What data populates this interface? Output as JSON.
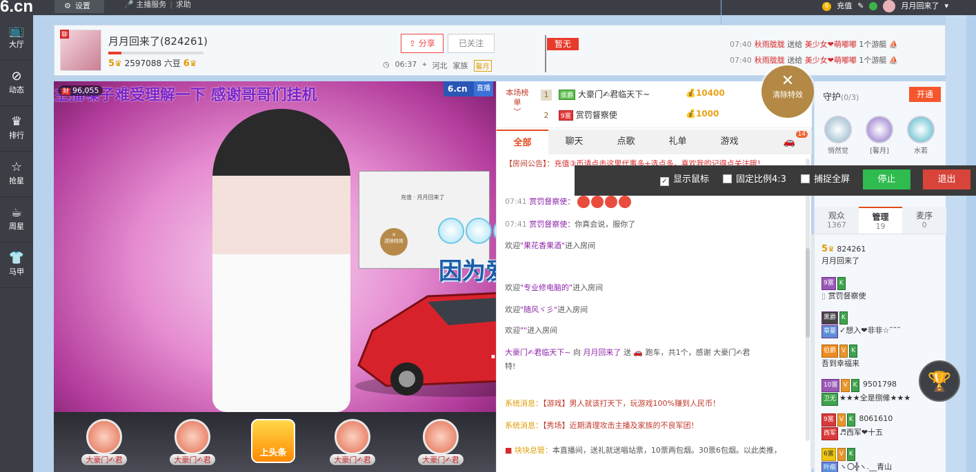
{
  "topbar": {
    "logo_text": "6.cn",
    "settings_label": "设置",
    "links": [
      "主播服务",
      "求助"
    ],
    "recharge_label": "充值",
    "user_name": "月月回来了"
  },
  "sidebar": {
    "items": [
      {
        "label": "大厅",
        "icon": "tv-icon",
        "glyph": "📺"
      },
      {
        "label": "动态",
        "icon": "compass-icon",
        "glyph": "⊘"
      },
      {
        "label": "排行",
        "icon": "crown-icon",
        "glyph": "♛"
      },
      {
        "label": "抢星",
        "icon": "star-icon",
        "glyph": "☆"
      },
      {
        "label": "周星",
        "icon": "cup-icon",
        "glyph": "☕"
      },
      {
        "label": "马甲",
        "icon": "shirt-icon",
        "glyph": "👕"
      }
    ]
  },
  "header": {
    "avatar_tag": "聊",
    "host_name": "月月回来了(824261)",
    "level_left": "5",
    "beans": "2597088 六豆",
    "level_right": "6",
    "share_label": "分享",
    "follow_label": "已关注",
    "time": "06:37",
    "location": "河北",
    "family_label": "家族",
    "family_tag": "馨月",
    "flag_label": "暂无"
  },
  "gift_feed": [
    {
      "time": "07:40",
      "from": "秋雨胧胧",
      "verb": "送给",
      "to": "美少女❤萌嘟嘟",
      "item": "1个游艇"
    },
    {
      "time": "07:40",
      "from": "秋雨胧胧",
      "verb": "送给",
      "to": "美少女❤萌嘟嘟",
      "item": "1个游艇"
    }
  ],
  "video": {
    "overlay_text": "主播嗓子难受理解一下    感谢哥哥们挂机",
    "viewer_tag": "财",
    "viewers": "96,055",
    "logo": "6.cn",
    "live_label": "直播",
    "subtitle": "因为爱你我哭过笑过",
    "mini_clear": "清除特效",
    "mini_recharge": "充值",
    "mini_user": "月月回来了"
  },
  "seats": {
    "label": "大豪门✍君",
    "top_label": "上头条"
  },
  "ranking": {
    "label": "本场榜单",
    "rows": [
      {
        "rank": "1",
        "badge": "侯爵",
        "name": "大豪门✍君临天下~",
        "value": "10400"
      },
      {
        "rank": "2",
        "badge": "9富",
        "name": "赏罚督察使",
        "value": "1000"
      }
    ]
  },
  "clear_effects": "清除特效",
  "chat": {
    "tabs": [
      "全部",
      "聊天",
      "点歌",
      "礼单",
      "游戏"
    ],
    "car_count": "14",
    "messages": [
      {
        "kind": "notice",
        "label": "【房间公告】：",
        "text": "充值③币请点击这里代事多+选点多，喜欢我的记得点关注哦！"
      },
      {
        "kind": "emote",
        "time": "07:41",
        "user": "赏罚督察使",
        "text": "："
      },
      {
        "kind": "say",
        "time": "07:41",
        "user": "赏罚督察使",
        "text": "：你真会说，服你了"
      },
      {
        "kind": "welcome",
        "pre": "欢迎",
        "user": "\"果花香果酒\"",
        "post": "进入房间"
      },
      {
        "kind": "welcome",
        "pre": "欢迎",
        "user": "\"专业修电脑的\"",
        "post": "进入房间"
      },
      {
        "kind": "welcome",
        "pre": "欢迎",
        "user": "\"随风ヾ彡\"",
        "post": "进入房间"
      },
      {
        "kind": "welcome",
        "pre": "欢迎",
        "user": "\"\"",
        "post": "进入房间"
      },
      {
        "kind": "gift",
        "user": "大豪门✍君临天下~",
        "mid": "向",
        "to": "月月回来了",
        "text": "送 🚗 跑车，共1个，感谢 大豪门✍君"
      },
      {
        "kind": "plain",
        "text": "特!"
      },
      {
        "kind": "sys",
        "label": "系统消息：",
        "text": "【游戏】男人就该打天下，玩游戏100%赚到人民币！"
      },
      {
        "kind": "sys",
        "label": "系统消息：",
        "text": "【秀场】近期清理攻击主播及家族的不良军团！"
      },
      {
        "kind": "sys2",
        "label": "块块总管：",
        "text": "本直播间，送礼就送唱站票，10票两包烟。30票6包烟。以此类推，"
      }
    ]
  },
  "toolbar": {
    "show_mouse": "显示鼠标",
    "fixed_ratio": "固定比例4:3",
    "capture_full": "捕捉全屏",
    "stop": "停止",
    "exit": "退出"
  },
  "guard": {
    "title": "守护",
    "count": "(0/3)",
    "open_label": "开通",
    "members": [
      "悄然觉",
      "[馨月]",
      "水若"
    ]
  },
  "user_tabs": [
    {
      "label": "观众",
      "count": "1367"
    },
    {
      "label": "管理",
      "count": "19"
    },
    {
      "label": "麦序",
      "count": "0"
    }
  ],
  "users": [
    {
      "lv": "5",
      "id": "824261",
      "name": "月月回来了"
    },
    {
      "badge": "9富",
      "k": "K",
      "name": "赏罚督察使"
    },
    {
      "badge": "黑爵",
      "k": "K",
      "tag": "草蔓",
      "name": "✓想入❤非非☆˜˜˜"
    },
    {
      "badge": "伯爵",
      "v": "V",
      "k": "K",
      "name": "吾到幸福来"
    },
    {
      "badge": "10富",
      "v": "V",
      "k": "K",
      "id": "9501798",
      "tag": "卫无",
      "name": "★★★全是捌絛★★★"
    },
    {
      "badge": "9富",
      "v": "V",
      "k": "K",
      "id": "8061610",
      "tag": "西军",
      "name": "♬西军❤十五"
    },
    {
      "badge": "6富",
      "v": "V",
      "k": "K",
      "tag": "叶痕",
      "name": "ヽ〇╬ヽ.__青山"
    }
  ]
}
